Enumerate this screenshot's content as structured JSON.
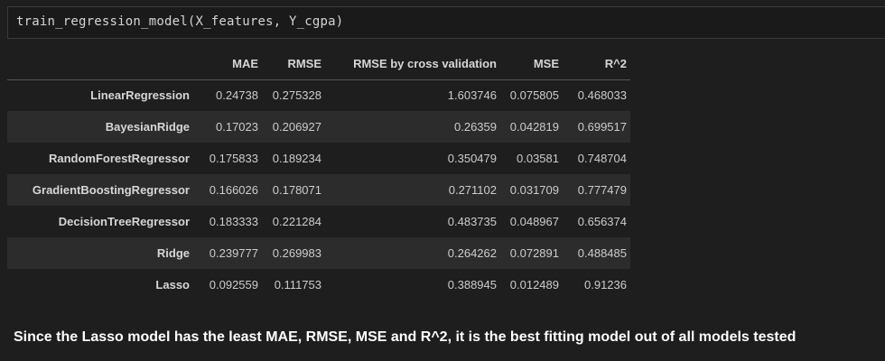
{
  "code_cell": {
    "code": "train_regression_model(X_features, Y_cgpa)"
  },
  "table": {
    "headers": [
      "",
      "MAE",
      "RMSE",
      "RMSE by cross validation",
      "MSE",
      "R^2"
    ],
    "rows": [
      {
        "name": "LinearRegression",
        "mae": "0.24738",
        "rmse": "0.275328",
        "rmse_cv": "1.603746",
        "mse": "0.075805",
        "r2": "0.468033"
      },
      {
        "name": "BayesianRidge",
        "mae": "0.17023",
        "rmse": "0.206927",
        "rmse_cv": "0.26359",
        "mse": "0.042819",
        "r2": "0.699517"
      },
      {
        "name": "RandomForestRegressor",
        "mae": "0.175833",
        "rmse": "0.189234",
        "rmse_cv": "0.350479",
        "mse": "0.03581",
        "r2": "0.748704"
      },
      {
        "name": "GradientBoostingRegressor",
        "mae": "0.166026",
        "rmse": "0.178071",
        "rmse_cv": "0.271102",
        "mse": "0.031709",
        "r2": "0.777479"
      },
      {
        "name": "DecisionTreeRegressor",
        "mae": "0.183333",
        "rmse": "0.221284",
        "rmse_cv": "0.483735",
        "mse": "0.048967",
        "r2": "0.656374"
      },
      {
        "name": "Ridge",
        "mae": "0.239777",
        "rmse": "0.269983",
        "rmse_cv": "0.264262",
        "mse": "0.072891",
        "r2": "0.488485"
      },
      {
        "name": "Lasso",
        "mae": "0.092559",
        "rmse": "0.111753",
        "rmse_cv": "0.388945",
        "mse": "0.012489",
        "r2": "0.91236"
      }
    ]
  },
  "summary": {
    "text": "Since the Lasso model has the least MAE, RMSE, MSE and R^2, it is the best fitting model out of all models tested"
  },
  "colors": {
    "background": "#1e1e1e",
    "row_stripe": "#2c2c2c",
    "text": "#cccccc",
    "summary_text": "#ffffff"
  }
}
